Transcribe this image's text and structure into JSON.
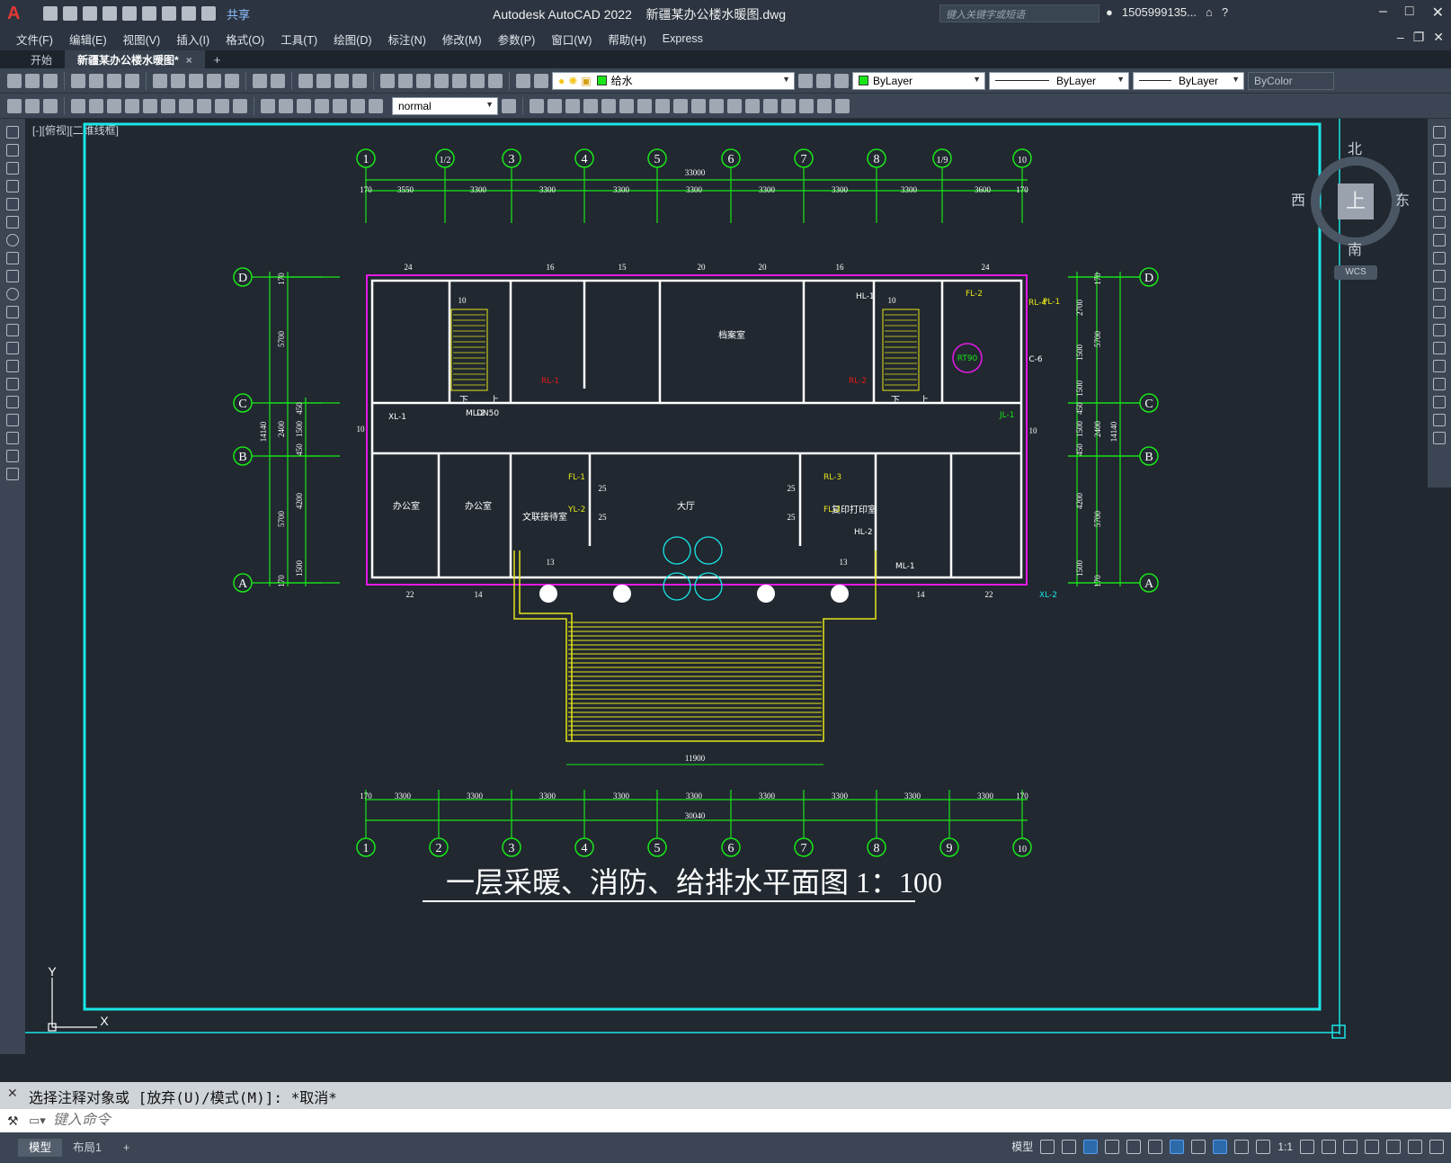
{
  "app": {
    "title": "Autodesk AutoCAD 2022",
    "filename": "新疆某办公楼水暖图.dwg",
    "share_label": "共享",
    "search_placeholder": "键入关键字或短语",
    "user": "1505999135...",
    "logo": "A"
  },
  "menu": [
    "文件(F)",
    "编辑(E)",
    "视图(V)",
    "插入(I)",
    "格式(O)",
    "工具(T)",
    "绘图(D)",
    "标注(N)",
    "修改(M)",
    "参数(P)",
    "窗口(W)",
    "帮助(H)",
    "Express"
  ],
  "tabs": {
    "start": "开始",
    "active": "新疆某办公楼水暖图*",
    "close_glyph": "×",
    "add_glyph": "+"
  },
  "toolbar": {
    "layer_value": "给水",
    "color_value": "ByLayer",
    "linetype_value": "ByLayer",
    "lineweight_value": "ByLayer",
    "plotstyle_value": "ByColor",
    "textstyle_value": "normal",
    "layer_color": "#19e619"
  },
  "viewport": {
    "label": "[-][俯视][二维线框]",
    "viewcube": {
      "north": "北",
      "south": "南",
      "east": "东",
      "west": "西",
      "face": "上",
      "wcs": "WCS"
    },
    "ucs_x": "X",
    "ucs_y": "Y"
  },
  "drawing": {
    "title": "一层采暖、消防、给排水平面图 1：100",
    "grid_top": [
      "1",
      "1/2",
      "3",
      "4",
      "5",
      "6",
      "7",
      "8",
      "1/9",
      "10"
    ],
    "grid_bottom": [
      "1",
      "2",
      "3",
      "4",
      "5",
      "6",
      "7",
      "8",
      "9",
      "10"
    ],
    "grid_rows": [
      "D",
      "C",
      "B",
      "A"
    ],
    "dim_top_total": "33000",
    "dim_top": [
      "170",
      "3550",
      "3300",
      "3300",
      "3300",
      "3300",
      "3300",
      "3300",
      "3300",
      "3600",
      "170"
    ],
    "dim_bottom_total": "30040",
    "dim_bottom": [
      "170",
      "3300",
      "3300",
      "3300",
      "3300",
      "3300",
      "3300",
      "3300",
      "3300",
      "3300",
      "170"
    ],
    "dim_left_total": "14140",
    "dim_left": [
      "170",
      "5700",
      "2400",
      "5700",
      "170"
    ],
    "dim_left_inner": [
      "450",
      "1500",
      "450",
      "4200",
      "1500"
    ],
    "dim_right_total": "14140",
    "dim_right": [
      "170",
      "5700",
      "2400",
      "5700",
      "170"
    ],
    "dim_right_inner": [
      "2700",
      "1500",
      "1500",
      "450",
      "1500",
      "450",
      "4200",
      "1500"
    ],
    "stair_width": "11900",
    "rooms": [
      "档案室",
      "办公室",
      "办公室",
      "文联接待室",
      "大厅",
      "复印打印室"
    ],
    "radiator_counts_top": [
      "24",
      "16",
      "15",
      "20",
      "20",
      "16",
      "24"
    ],
    "radiator_counts_bottom": [
      "22",
      "14",
      "13",
      "13",
      "14",
      "22"
    ],
    "radiator_counts_side": [
      "10",
      "10",
      "10",
      "10",
      "25",
      "25",
      "25",
      "25"
    ],
    "pipe_tags": [
      "XL-1",
      "XL-2",
      "HL-1",
      "HL-2",
      "RL-1",
      "RL-2",
      "RL-3",
      "FL-1",
      "FL-2",
      "FL-3",
      "PL-1",
      "ML-1",
      "ML-2",
      "JL-1",
      "YL-2",
      "RL-4"
    ],
    "misc_tags": [
      "RT90",
      "C-6",
      "DN50"
    ],
    "stair_labels": [
      "下",
      "上",
      "下",
      "上"
    ]
  },
  "command": {
    "history": "选择注释对象或 [放弃(U)/模式(M)]: *取消*",
    "placeholder": "键入命令"
  },
  "status": {
    "layout_tabs": [
      "模型",
      "布局1"
    ],
    "add_tab": "+",
    "model_label": "模型",
    "scale": "1:1"
  },
  "colors": {
    "titlebar": "#2b3440",
    "viewport_bg": "#212830",
    "cyan": "#19e6e6",
    "green": "#19e619",
    "magenta": "#e619e6",
    "yellow": "#e6e619",
    "red": "#e61919"
  }
}
